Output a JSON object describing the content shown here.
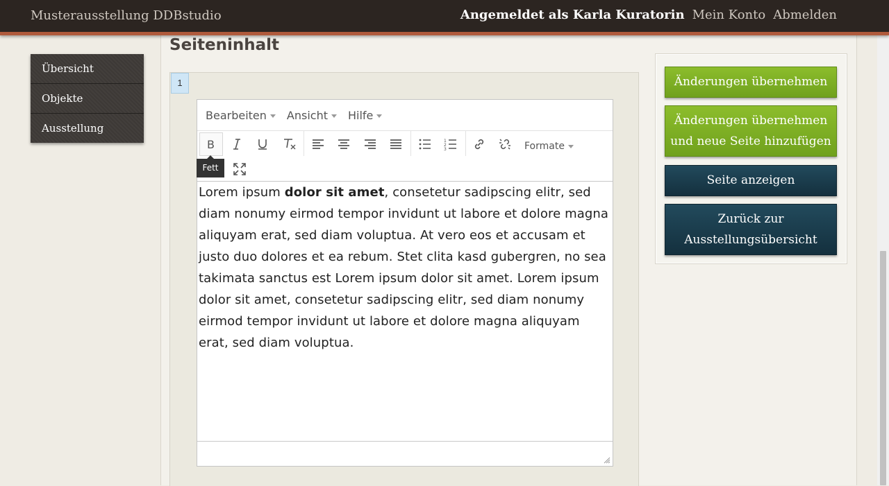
{
  "header": {
    "site_title": "Musterausstellung DDBstudio",
    "logged_in_as": "Angemeldet als Karla Kuratorin",
    "account_link": "Mein Konto",
    "logout_link": "Abmelden"
  },
  "sidebar": {
    "items": [
      {
        "label": "Übersicht"
      },
      {
        "label": "Objekte"
      },
      {
        "label": "Ausstellung"
      }
    ]
  },
  "section": {
    "title": "Seiteninhalt",
    "page_number": "1"
  },
  "editor": {
    "menu": [
      {
        "label": "Bearbeiten"
      },
      {
        "label": "Ansicht"
      },
      {
        "label": "Hilfe"
      }
    ],
    "toolbar_icons": [
      "bold-icon",
      "italic-icon",
      "underline-icon",
      "clear-formatting-icon",
      "align-left-icon",
      "align-center-icon",
      "align-right-icon",
      "align-justify-icon",
      "bullet-list-icon",
      "numbered-list-icon",
      "link-icon",
      "unlink-icon",
      "fullscreen-icon"
    ],
    "formats_label": "Formate",
    "tooltip": "Fett",
    "content": {
      "before_bold": "Lorem ipsum ",
      "bold": "dolor sit amet",
      "after_bold": ", consetetur sadipscing elitr, sed diam nonumy eirmod tempor invidunt ut labore et dolore magna aliquyam erat, sed diam voluptua. At vero eos et accusam et justo duo dolores et ea rebum. Stet clita kasd gubergren, no sea takimata sanctus est Lorem ipsum dolor sit amet. Lorem ipsum dolor sit amet, consetetur sadipscing elitr, sed diam nonumy eirmod tempor invidunt ut labore et dolore magna aliquyam erat, sed diam voluptua."
    }
  },
  "actions": {
    "apply": "Änderungen übernehmen",
    "apply_add_page": "Änderungen übernehmen und neue Seite hinzufügen",
    "show_page": "Seite anzeigen",
    "back": "Zurück zur Ausstellungsübersicht"
  },
  "colors": {
    "topbar": "#2c2521",
    "accent_line": "#b05a3c",
    "green_button": "#7cab22",
    "blue_button": "#1b3d4e",
    "page_tab": "#cfe6f6"
  }
}
